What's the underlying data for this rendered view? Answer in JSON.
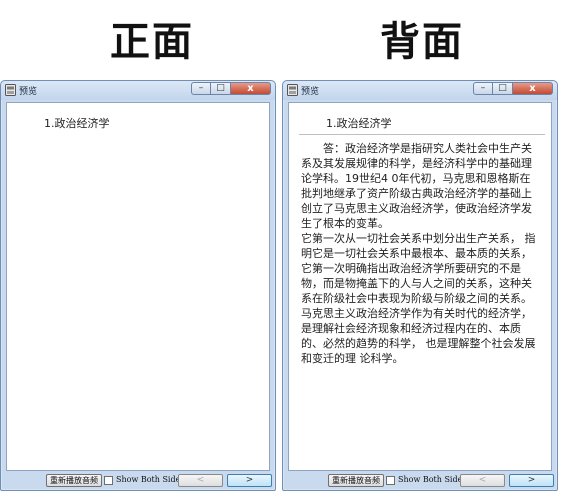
{
  "captions": {
    "front": "正面",
    "back": "背面"
  },
  "windows": [
    {
      "title": "预览",
      "question": "1.政治经济学",
      "answer": ""
    },
    {
      "title": "预览",
      "question": "1.政治经济学",
      "answer": "答：政治经济学是指研究人类社会中生产关系及其发展规律的科学，是经济科学中的基础理 论学科。19世纪4 0年代初，马克思和恩格斯在批判地继承了资产阶级古典政治经济学的基础上创立了马克思主义政治经济学，使政治经济学发生了根本的变革。\n它第一次从一切社会关系中划分出生产关系， 指明它是一切社会关系中最根本、最本质的关系，它第一次明确指出政治经济学所要研究的不是物，而是物掩盖下的人与人之间的关系，这种关系在阶级社会中表现为阶级与阶级之间的关系。马克思主义政治经济学作为有关时代的经济学， 是理解社会经济现象和经济过程内在的、本质的、必然的趋势的科学， 也是理解整个社会发展和变迁的理 论科学。"
    }
  ],
  "footer": {
    "reset_label": "重新播放音频",
    "show_both_label": "Show Both Sides",
    "prev_label": "<",
    "next_label": ">"
  },
  "window_controls": {
    "minimize": "–",
    "maximize": "□",
    "close": "x"
  }
}
